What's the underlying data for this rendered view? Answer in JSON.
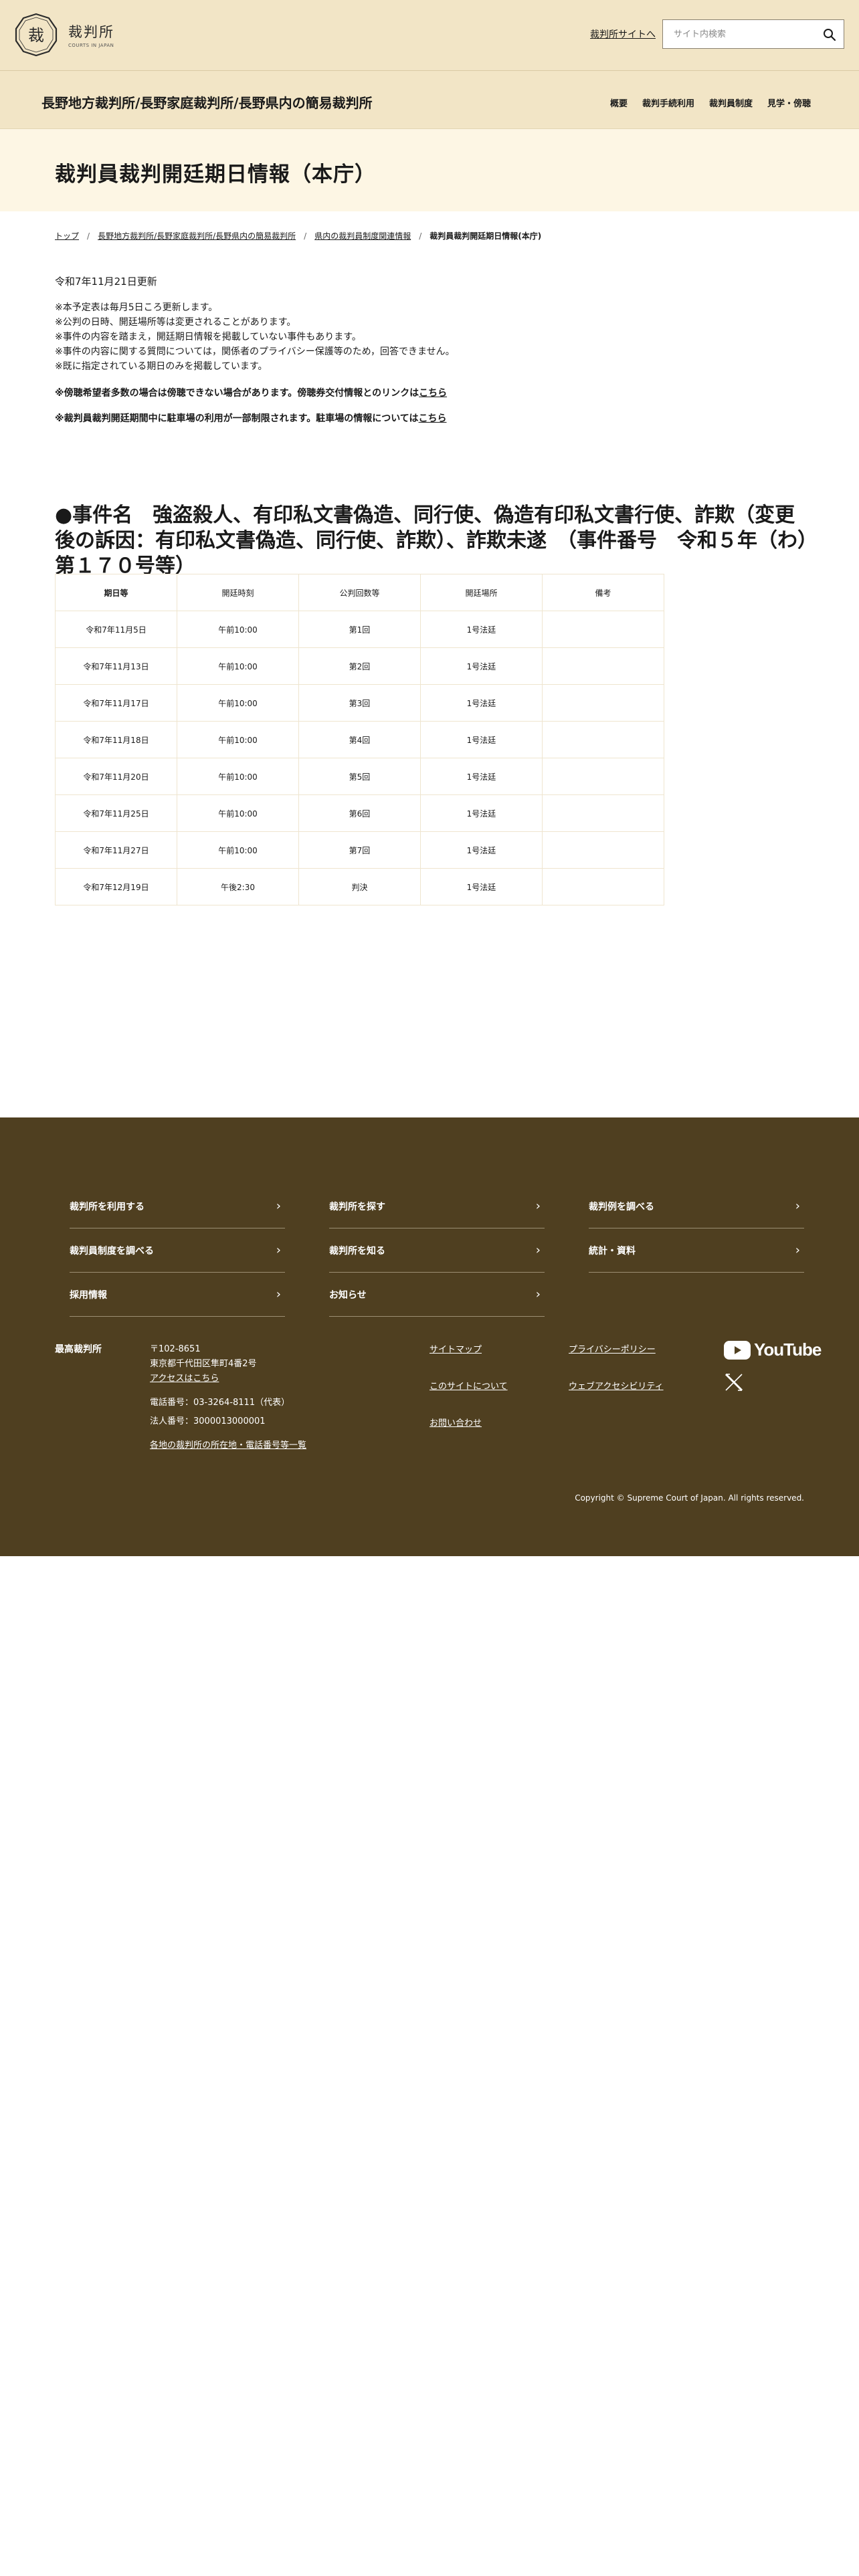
{
  "header": {
    "logo_text": "裁判所",
    "logo_sub": "COURTS IN JAPAN",
    "site_link": "裁判所サイトへ",
    "search_placeholder": "サイト内検索"
  },
  "subheader": {
    "court_name": "長野地方裁判所/長野家庭裁判所/長野県内の簡易裁判所",
    "nav": [
      "概要",
      "裁判手続利用",
      "裁判員制度",
      "見学・傍聴"
    ]
  },
  "page": {
    "title": "裁判員裁判開廷期日情報（本庁）"
  },
  "breadcrumb": {
    "items": [
      "トップ",
      "長野地方裁判所/長野家庭裁判所/長野県内の簡易裁判所",
      "県内の裁判員制度関連情報"
    ],
    "current": "裁判員裁判開廷期日情報(本庁)",
    "separator": "/"
  },
  "content": {
    "updated": "令和7年11月21日更新",
    "notes": [
      "※本予定表は毎月5日ころ更新します。",
      "※公判の日時、開廷場所等は変更されることがあります。",
      "※事件の内容を踏まえ，開廷期日情報を掲載していない事件もあります。",
      "※事件の内容に関する質問については，関係者のプライバシー保護等のため，回答できません。",
      "※既に指定されている期日のみを掲載しています。"
    ],
    "info1_text": "※傍聴希望者多数の場合は傍聴できない場合があります。傍聴券交付情報とのリンクは",
    "info1_link": "こちら",
    "info2_text": "※裁判員裁判開廷期間中に駐車場の利用が一部制限されます。駐車場の情報については",
    "info2_link": "こちら",
    "case_heading": "●事件名　強盗殺人、有印私文書偽造、同行使、偽造有印私文書行使、詐欺（変更後の訴因：有印私文書偽造、同行使、詐欺）、詐欺未遂　（事件番号　令和５年（わ）第１７０号等）"
  },
  "table": {
    "headers": [
      "期日等",
      "開廷時刻",
      "公判回数等",
      "開廷場所",
      "備考"
    ],
    "rows": [
      [
        "令和7年11月5日",
        "午前10:00",
        "第1回",
        "1号法廷",
        ""
      ],
      [
        "令和7年11月13日",
        "午前10:00",
        "第2回",
        "1号法廷",
        ""
      ],
      [
        "令和7年11月17日",
        "午前10:00",
        "第3回",
        "1号法廷",
        ""
      ],
      [
        "令和7年11月18日",
        "午前10:00",
        "第4回",
        "1号法廷",
        ""
      ],
      [
        "令和7年11月20日",
        "午前10:00",
        "第5回",
        "1号法廷",
        ""
      ],
      [
        "令和7年11月25日",
        "午前10:00",
        "第6回",
        "1号法廷",
        ""
      ],
      [
        "令和7年11月27日",
        "午前10:00",
        "第7回",
        "1号法廷",
        ""
      ],
      [
        "令和7年12月19日",
        "午後2:30",
        "判決",
        "1号法廷",
        ""
      ]
    ]
  },
  "footer": {
    "nav": [
      "裁判所を利用する",
      "裁判所を探す",
      "裁判例を調べる",
      "裁判員制度を調べる",
      "裁判所を知る",
      "統計・資料",
      "採用情報",
      "お知らせ"
    ],
    "org_name": "最高裁判所",
    "postal": "〒102-8651",
    "address": "東京都千代田区隼町4番2号",
    "access_link": "アクセスはこちら",
    "phone": "電話番号：03-3264-8111（代表）",
    "corp_number": "法人番号：3000013000001",
    "directory_link": "各地の裁判所の所在地・電話番号等一覧",
    "links_col1": [
      "サイトマップ",
      "このサイトについて",
      "お問い合わせ"
    ],
    "links_col2": [
      "プライバシーポリシー",
      "ウェブアクセシビリティ"
    ],
    "youtube_label": "YouTube",
    "copyright": "Copyright © Supreme Court of Japan. All rights reserved."
  },
  "colors": {
    "header_bg": "#f2e5c6",
    "title_band_bg": "#fdf6e4",
    "footer_bg": "#4f3f20",
    "table_border": "#efe5cf"
  },
  "icons": {
    "search": "search-icon",
    "chevron": "chevron-right-icon",
    "youtube": "youtube-icon",
    "x": "x-icon",
    "logo": "court-emblem-icon"
  }
}
